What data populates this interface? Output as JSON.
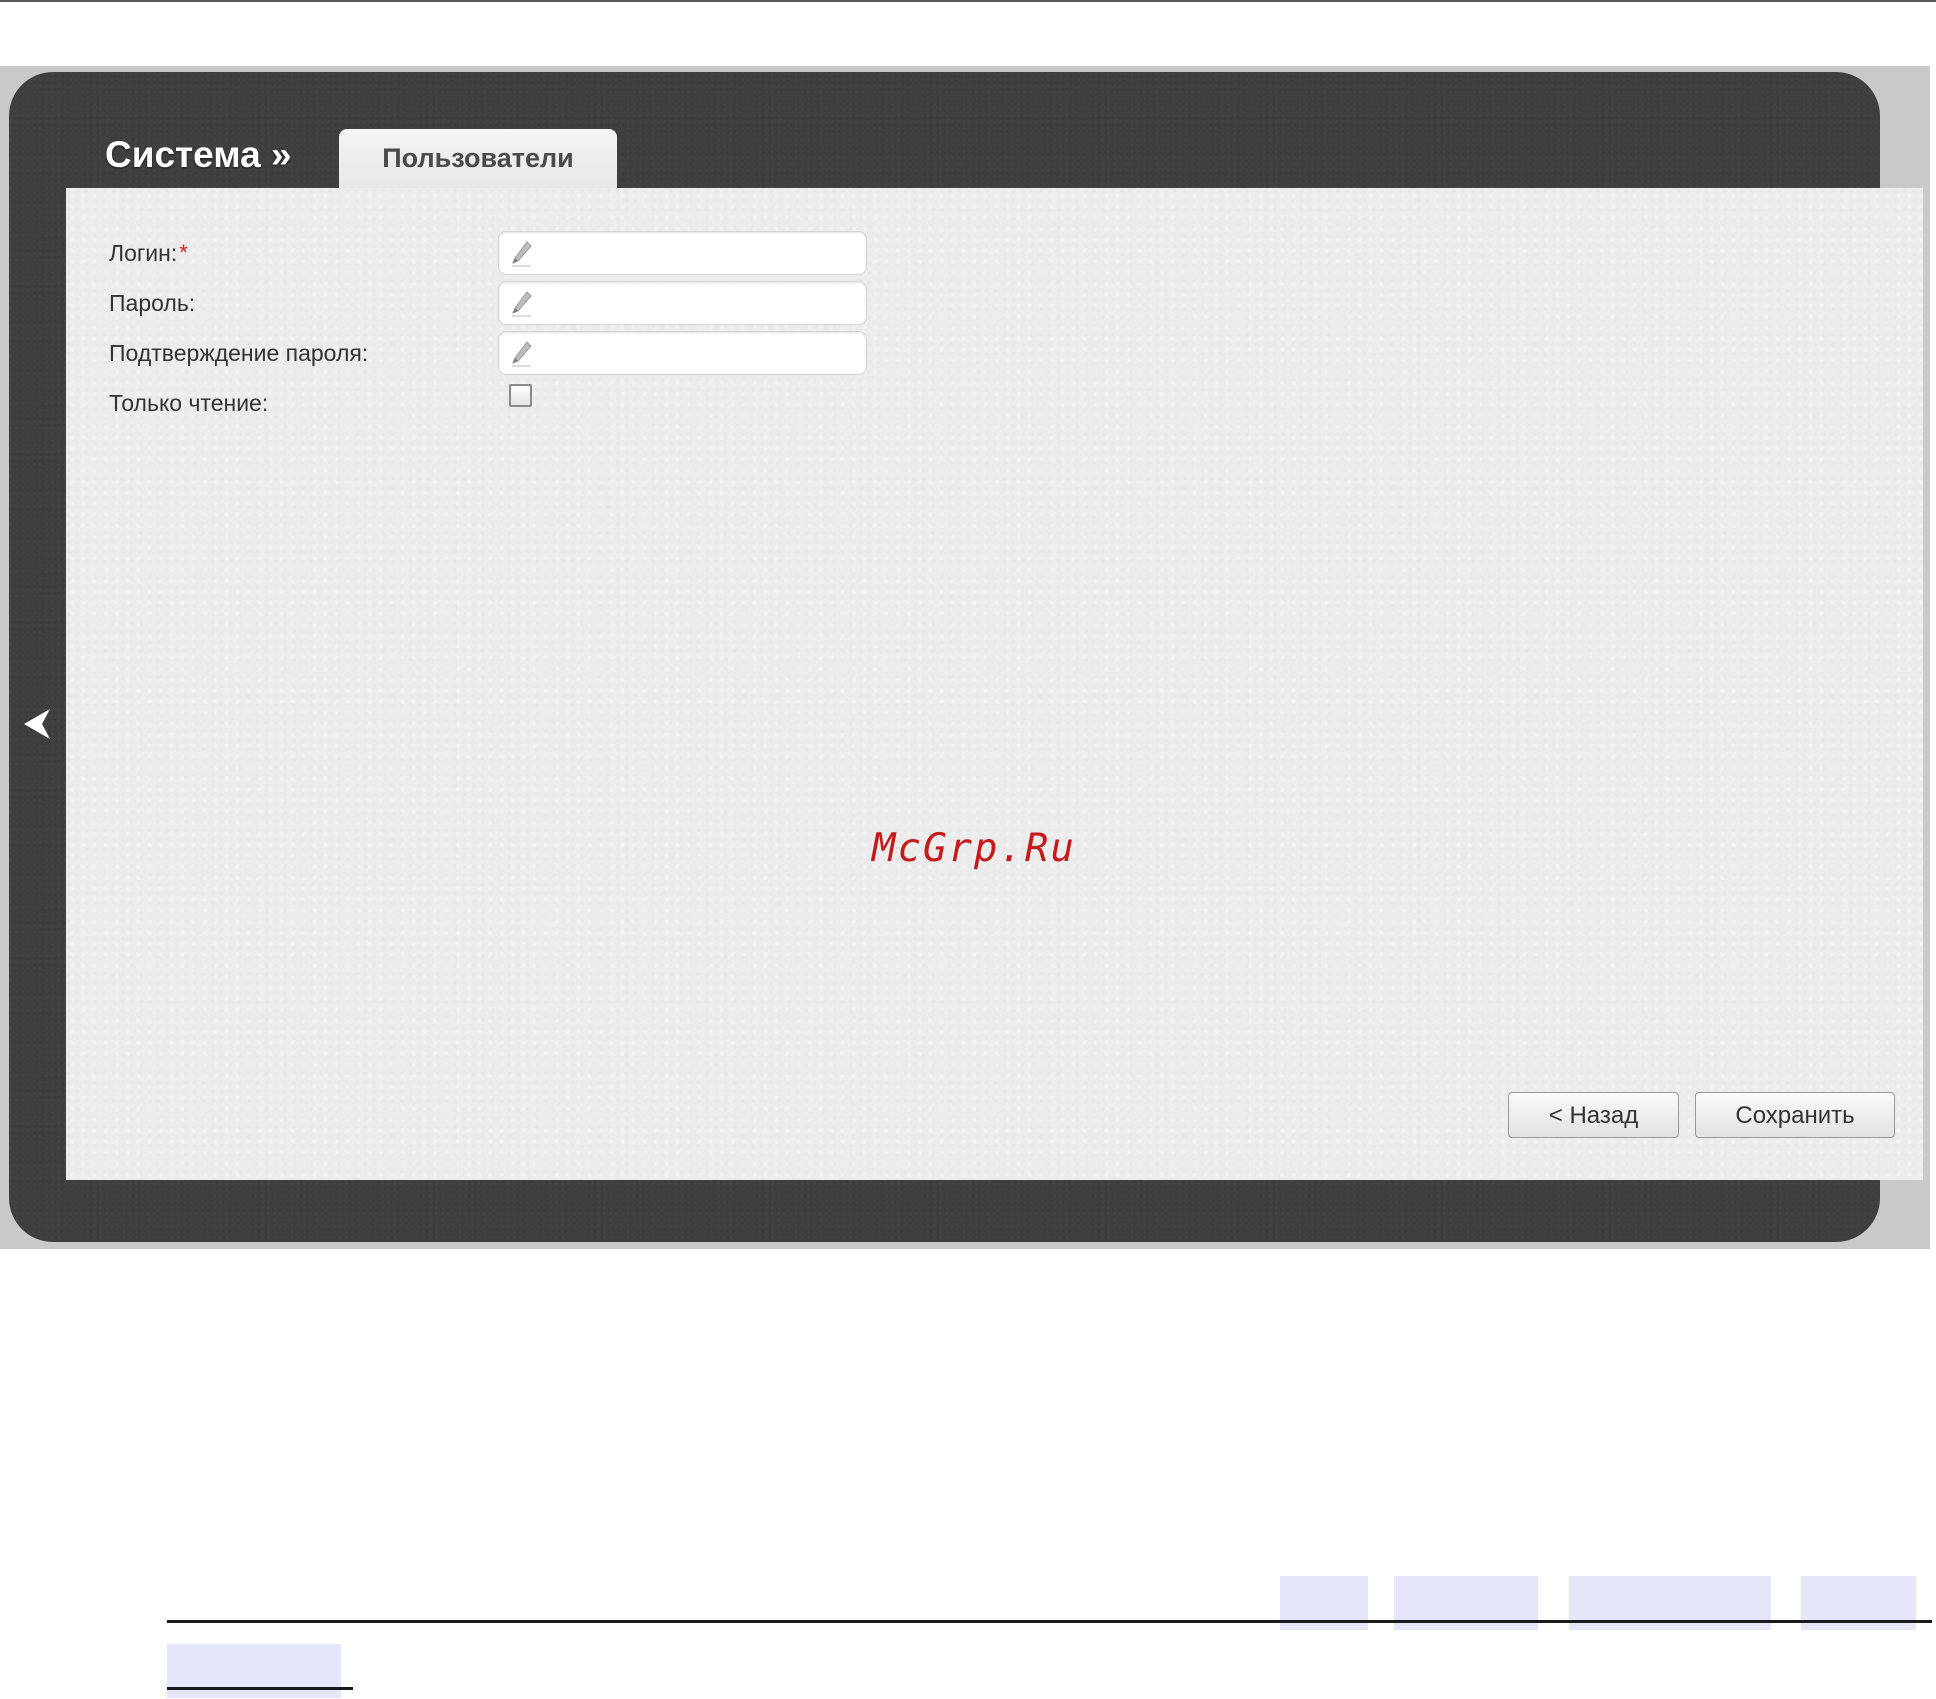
{
  "header": {
    "section_title": "Система »",
    "active_tab": "Пользователи"
  },
  "form": {
    "login_label": "Логин:",
    "required_mark": "*",
    "password_label": "Пароль:",
    "confirm_label": "Подтверждение пароля:",
    "readonly_label": "Только чтение:",
    "login_value": "",
    "password_value": "",
    "confirm_value": "",
    "readonly_checked": false
  },
  "buttons": {
    "back_label": "< Назад",
    "save_label": "Сохранить"
  },
  "watermark": "McGrp.Ru",
  "icons": {
    "field_icon": "pencil-icon",
    "nav_icon": "back-arrow-icon"
  },
  "colors": {
    "frame": "#3f3f3f",
    "panel": "#ececec",
    "required": "#d42222",
    "watermark": "#c41a1a"
  }
}
